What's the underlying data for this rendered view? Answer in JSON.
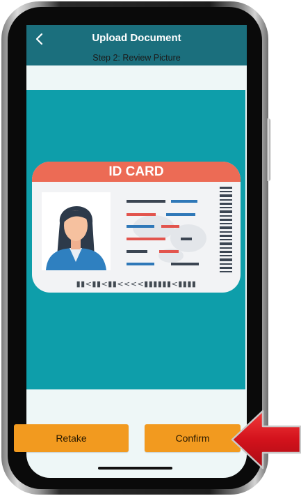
{
  "header": {
    "title": "Upload Document",
    "back_icon": "chevron-left-icon"
  },
  "step": {
    "label": "Step 2: Review Picture"
  },
  "id_card": {
    "title": "ID CARD",
    "bottom_code": "▮▮<▮▮<▮▮<<<<▮▮▮▮▮▮<▮▮▮▮"
  },
  "actions": {
    "retake_label": "Retake",
    "confirm_label": "Confirm"
  },
  "colors": {
    "header_bg": "#1b6f7d",
    "photo_bg": "#0e9eaa",
    "card_header": "#ec6b55",
    "button": "#f29a1f",
    "arrow": "#d3121c"
  }
}
